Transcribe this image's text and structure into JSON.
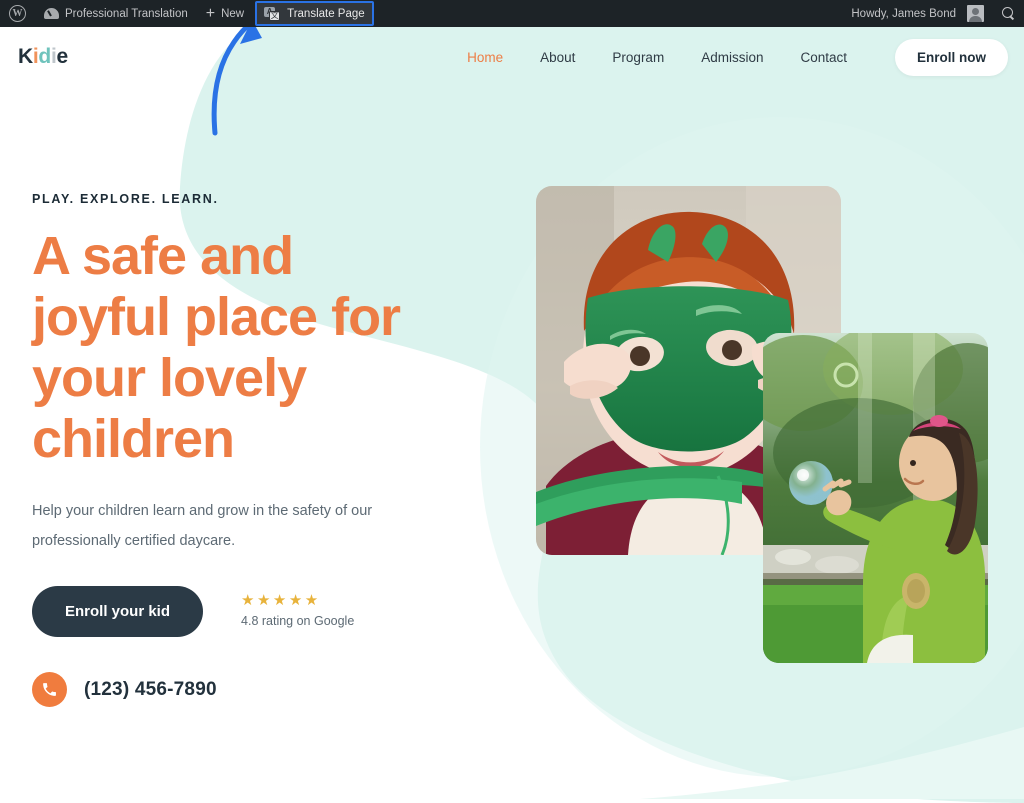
{
  "admin_bar": {
    "wp_logo_label": "W",
    "items": [
      {
        "id": "site-name",
        "label": "Professional Translation",
        "icon": "gauge-icon"
      },
      {
        "id": "new-content",
        "label": "New",
        "icon": "plus-icon"
      },
      {
        "id": "translate-page",
        "label": "Translate Page",
        "icon": "translate-icon",
        "highlighted": true
      }
    ],
    "greeting": "Howdy, James Bond",
    "search_icon": "search-icon",
    "avatar": "user-avatar",
    "highlight_color": "#2a72e5",
    "background_color": "#1d2327"
  },
  "site_header": {
    "logo": {
      "text": "Kidie",
      "letters": [
        {
          "char": "K",
          "color": "#22313c"
        },
        {
          "char": "i",
          "color": "#F0935B"
        },
        {
          "char": "d",
          "color": "#6FC3BC"
        },
        {
          "char": "i",
          "color": "#BFC6CB"
        },
        {
          "char": "e",
          "color": "#22313c"
        }
      ]
    },
    "nav": [
      {
        "label": "Home",
        "active": true
      },
      {
        "label": "About",
        "active": false
      },
      {
        "label": "Program",
        "active": false
      },
      {
        "label": "Admission",
        "active": false
      },
      {
        "label": "Contact",
        "active": false
      }
    ],
    "cta_label": "Enroll now"
  },
  "hero": {
    "eyebrow": "PLAY. EXPLORE. LEARN.",
    "heading_lines": [
      "A safe and",
      "joyful place for",
      "your lovely",
      "children"
    ],
    "heading_text": "A safe and joyful place for your lovely children",
    "paragraph": "Help your children learn and grow in the safety of our professionally certified daycare.",
    "cta_label": "Enroll your kid",
    "rating": {
      "stars": "★★★★★",
      "stars_count": 5,
      "value": "4.8",
      "text": "4.8 rating on Google"
    },
    "phone": {
      "icon": "phone-icon",
      "number": "(123) 456-7890"
    },
    "images": [
      {
        "id": "photo-main",
        "alt": "Child wearing a green dinosaur mask"
      },
      {
        "id": "photo-inset",
        "alt": "Girl in a green jacket reaching for a soap bubble outdoors"
      }
    ]
  },
  "colors": {
    "accent_orange": "#ED7D45",
    "phone_orange": "#F07C3E",
    "dark_navy": "#2b3a46",
    "blob_teal": "#DBF3EE",
    "star_gold": "#E8B33C",
    "annotation_blue": "#2a72e5",
    "page_background": "#ffffff"
  },
  "annotation": {
    "type": "curved-arrow",
    "points_to": "Translate Page",
    "color": "#2a72e5"
  }
}
